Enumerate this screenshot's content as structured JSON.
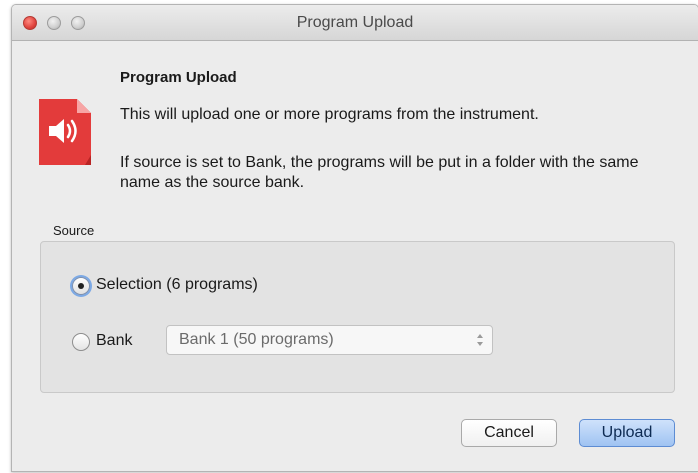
{
  "window": {
    "title": "Program Upload"
  },
  "dialog": {
    "heading": "Program Upload",
    "description": "This will upload one or more programs from the instrument.",
    "note": "If source is set to Bank, the programs will be put in a folder with the same name as the source bank.",
    "icon": "speaker-document-icon"
  },
  "source": {
    "label": "Source",
    "options": [
      {
        "label": "Selection (6 programs)",
        "selected": true
      },
      {
        "label": "Bank",
        "selected": false
      }
    ],
    "bank_select": {
      "value": "Bank 1 (50 programs)"
    }
  },
  "buttons": {
    "cancel": "Cancel",
    "upload": "Upload"
  },
  "colors": {
    "accent": "#9fc3f2",
    "icon_red": "#e03a3a",
    "close_button": "#e0443e"
  }
}
